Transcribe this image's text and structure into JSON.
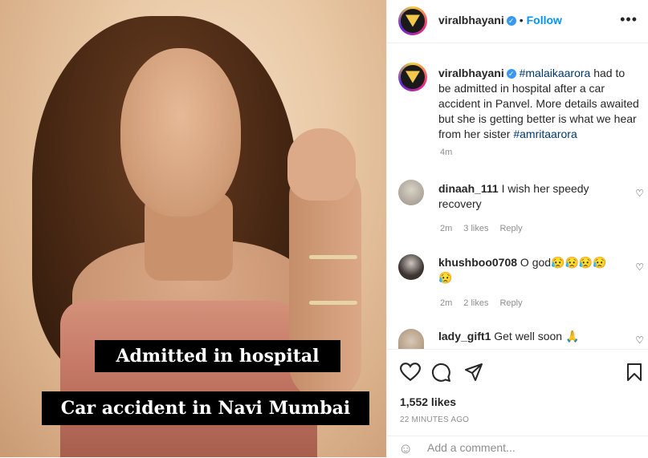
{
  "post_image": {
    "caption_line1": "Admitted in hospital",
    "caption_line2": "Car accident in Navi Mumbai"
  },
  "header": {
    "username": "viralbhayani",
    "separator": "•",
    "follow_label": "Follow",
    "more_icon": "more-horizontal-icon"
  },
  "post": {
    "username": "viralbhayani",
    "hashtag1": "#malaikaarora",
    "text": " had to be admitted in hospital after a car accident in Panvel. More details awaited but she is getting better is what we hear from her sister ",
    "hashtag2": "#amritaarora",
    "time": "4m"
  },
  "comments": [
    {
      "username": "dinaah_111",
      "text": "I wish her speedy recovery",
      "time": "2m",
      "likes": "3 likes",
      "reply": "Reply"
    },
    {
      "username": "khushboo0708",
      "text": "O god😥😥😥😥😥",
      "time": "2m",
      "likes": "2 likes",
      "reply": "Reply"
    },
    {
      "username": "lady_gift1",
      "text": "Get well soon 🙏"
    }
  ],
  "actions": {
    "like_icon": "heart-icon",
    "comment_icon": "comment-icon",
    "share_icon": "share-icon",
    "save_icon": "bookmark-icon",
    "likes": "1,552 likes",
    "time_ago": "22 MINUTES AGO"
  },
  "add_comment": {
    "emoji_icon": "emoji-icon",
    "placeholder": "Add a comment..."
  },
  "colors": {
    "link": "#0095f6",
    "hashtag": "#00376b",
    "muted": "#8e8e8e"
  }
}
